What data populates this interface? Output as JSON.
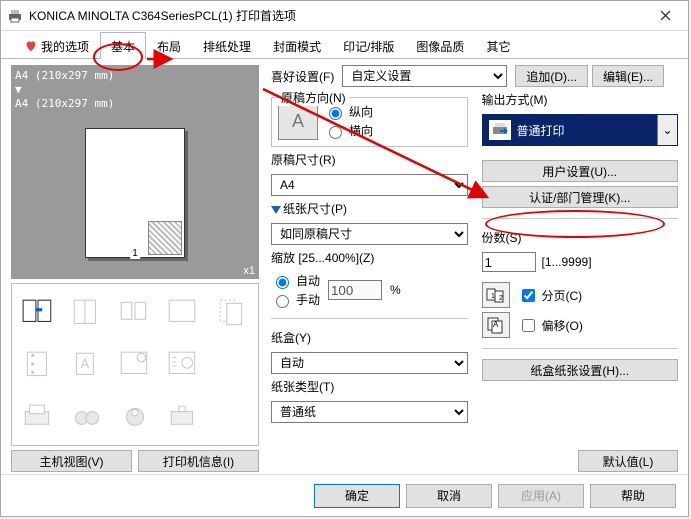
{
  "title": "KONICA MINOLTA C364SeriesPCL(1) 打印首选项",
  "tabs": {
    "my_options": "我的选项",
    "basic": "基本",
    "layout": "布局",
    "paper_handle": "排纸处理",
    "cover_mode": "封面模式",
    "stamp": "印记/排版",
    "quality": "图像品质",
    "other": "其它"
  },
  "preview": {
    "line1": "A4 (210x297 mm)",
    "arrow": "▼",
    "line2": "A4 (210x297 mm)",
    "pgnum": "1",
    "x": "x1",
    "btn_host": "主机视图(V)",
    "btn_printer": "打印机信息(I)"
  },
  "fav": {
    "label": "喜好设置(F)",
    "value": "自定义设置",
    "add": "追加(D)...",
    "edit": "编辑(E)..."
  },
  "orient": {
    "group": "原稿方向(N)",
    "portrait": "纵向",
    "landscape": "横向",
    "thumb_letter": "A"
  },
  "size": {
    "orig_label": "原稿尺寸(R)",
    "orig_value": "A4",
    "paper_label": "纸张尺寸(P)",
    "paper_value": "如同原稿尺寸"
  },
  "zoom": {
    "label": "缩放 [25...400%](Z)",
    "auto": "自动",
    "manual": "手动",
    "value": "100",
    "pct": "%"
  },
  "tray": {
    "label": "纸盒(Y)",
    "value": "自动"
  },
  "ptype": {
    "label": "纸张类型(T)",
    "value": "普通纸"
  },
  "output": {
    "label": "输出方式(M)",
    "value": "普通打印",
    "user_set": "用户设置(U)...",
    "auth": "认证/部门管理(K)..."
  },
  "copies": {
    "label": "份数(S)",
    "value": "1",
    "range": "[1...9999]",
    "collate": "分页(C)",
    "offset": "偏移(O)"
  },
  "tray_setting": "纸盒纸张设置(H)...",
  "default_btn": "默认值(L)",
  "footer": {
    "ok": "确定",
    "cancel": "取消",
    "apply": "应用(A)",
    "help": "帮助"
  }
}
